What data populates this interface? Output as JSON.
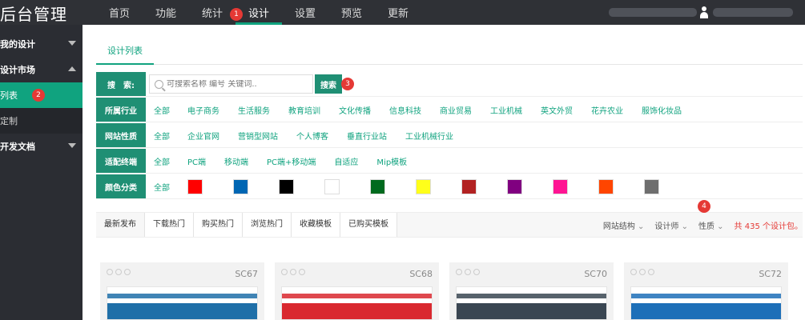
{
  "app": {
    "brand": "后台管理"
  },
  "nav": {
    "items": [
      "首页",
      "功能",
      "统计",
      "设计",
      "设置",
      "预览",
      "更新"
    ],
    "active_index": 3
  },
  "markers": [
    "1",
    "2",
    "3",
    "4"
  ],
  "sidebar": {
    "groups": [
      {
        "label": "我的设计",
        "expanded": false,
        "items": []
      },
      {
        "label": "设计市场",
        "expanded": true,
        "items": [
          {
            "label": "列表",
            "active": true
          },
          {
            "label": "定制",
            "active": false
          }
        ]
      },
      {
        "label": "开发文档",
        "expanded": false,
        "items": []
      }
    ]
  },
  "main": {
    "tab": "设计列表",
    "search": {
      "label": "搜　索:",
      "placeholder": "可搜索名称 编号 关键词..",
      "button": "搜索"
    },
    "filters": [
      {
        "label": "所属行业",
        "all": "全部",
        "options": [
          "电子商务",
          "生活服务",
          "教育培训",
          "文化传播",
          "信息科技",
          "商业贸易",
          "工业机械",
          "英文外贸",
          "花卉农业",
          "服饰化妆品"
        ]
      },
      {
        "label": "网站性质",
        "all": "全部",
        "options": [
          "企业官网",
          "营销型网站",
          "个人博客",
          "垂直行业站",
          "工业机械行业"
        ]
      },
      {
        "label": "适配终端",
        "all": "全部",
        "options": [
          "PC端",
          "移动端",
          "PC端+移动端",
          "自适应",
          "Mip模板"
        ]
      }
    ],
    "colors": {
      "label": "颜色分类",
      "all": "全部",
      "swatches": [
        "#ff0000",
        "#0066b3",
        "#000000",
        "#ffffff",
        "#006a1e",
        "#ffff1a",
        "#b22222",
        "#800080",
        "#ff1493",
        "#ff4500",
        "#6e6e6e"
      ]
    },
    "sort_tabs": [
      "最新发布",
      "下载热门",
      "购买热门",
      "浏览热门",
      "收藏模板",
      "已购买模板"
    ],
    "sort_dropdowns": [
      "网站结构",
      "设计师",
      "性质"
    ],
    "total": "共 435 个设计包。",
    "cards": [
      {
        "code": "SC67",
        "accent": "#1f6fa8"
      },
      {
        "code": "SC68",
        "accent": "#d9282f"
      },
      {
        "code": "SC70",
        "accent": "#3a4652"
      },
      {
        "code": "SC72",
        "accent": "#1d6fb8"
      }
    ]
  }
}
